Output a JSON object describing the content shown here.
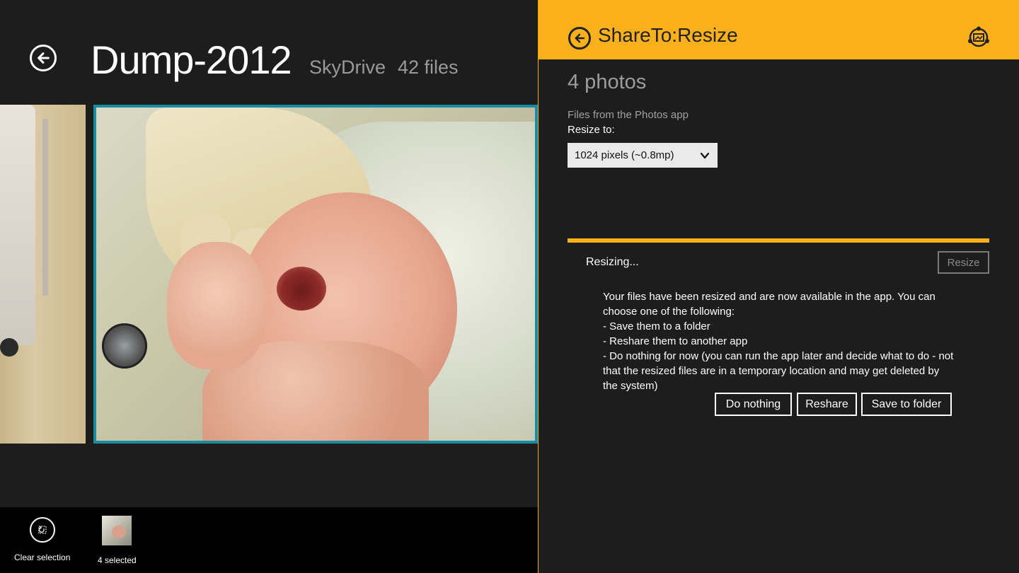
{
  "left_app": {
    "folder_title": "Dump-2012",
    "source": "SkyDrive",
    "file_count": "42 files",
    "appbar": {
      "clear_selection_label": "Clear selection",
      "selected_label": "4 selected"
    }
  },
  "share_pane": {
    "title": "ShareTo:Resize",
    "photos_count": "4 photos",
    "files_from": "Files from the Photos app",
    "resize_to_label": "Resize to:",
    "resize_option": "1024 pixels (~0.8mp)",
    "progress_percent": 100,
    "status": "Resizing...",
    "resize_button": "Resize",
    "message_lines": [
      "Your files have been resized and are now available in the app. You can choose one of the following:",
      "- Save them to a folder",
      "- Reshare them to another app",
      "- Do nothing for now (you can run the app later and decide what to do - not that the resized files are in a temporary location and may get deleted by the system)"
    ],
    "buttons": {
      "do_nothing": "Do nothing",
      "reshare": "Reshare",
      "save_to_folder": "Save to folder"
    },
    "accent_color": "#fbb01c"
  },
  "icons": {
    "back": "back-arrow-icon",
    "clear_selection": "clear-selection-icon",
    "app": "shareto-app-icon",
    "dropdown": "chevron-down-icon"
  }
}
